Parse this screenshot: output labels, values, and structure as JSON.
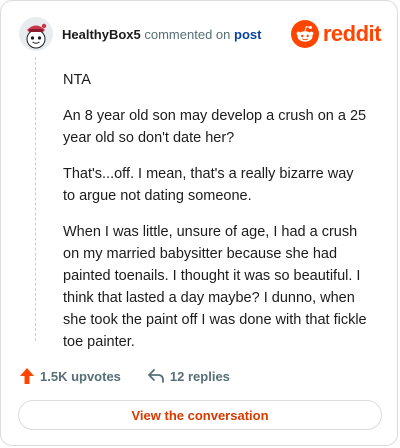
{
  "header": {
    "username": "HealthyBox5",
    "action_text": "commented on",
    "post_link_label": "post",
    "brand_name": "reddit",
    "avatar_icon": "snoo-avatar-icon",
    "brand_icon": "reddit-alien-icon"
  },
  "comment": {
    "paragraphs": [
      "NTA",
      "An 8 year old son may develop a crush on a 25 year old so don't date her?",
      "That's...off. I mean, that's a really bizarre way to argue not dating someone.",
      "When I was little, unsure of age, I had a crush on my married babysitter because she had painted toenails. I thought it was so beautiful. I think that lasted a day maybe? I dunno, when she took the paint off I was done with that fickle toe painter."
    ]
  },
  "stats": {
    "upvotes_label": "1.5K upvotes",
    "replies_label": "12 replies",
    "upvote_icon": "upvote-arrow-icon",
    "reply_icon": "reply-arrow-icon"
  },
  "cta": {
    "label": "View the conversation"
  },
  "colors": {
    "brand": "#ff4500",
    "link": "#0a449b",
    "cta_text": "#d93a00",
    "muted": "#576f76",
    "border": "#dadce0"
  }
}
